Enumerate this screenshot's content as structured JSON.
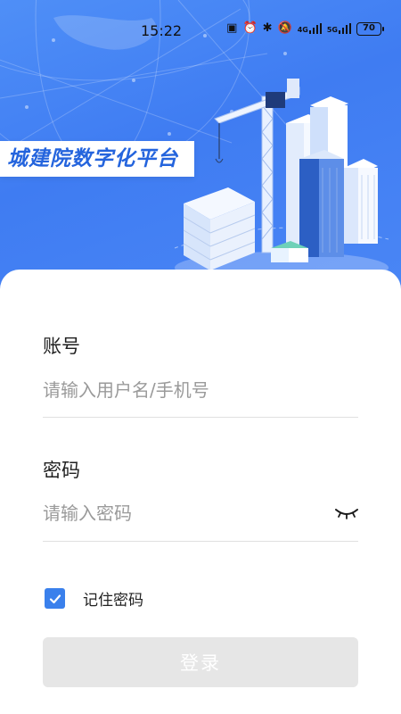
{
  "status_bar": {
    "time": "15:22",
    "network_4g": "4G",
    "network_5g": "5G",
    "battery": "70"
  },
  "app": {
    "title": "城建院数字化平台"
  },
  "form": {
    "account_label": "账号",
    "account_placeholder": "请输入用户名/手机号",
    "account_value": "",
    "password_label": "密码",
    "password_placeholder": "请输入密码",
    "password_value": "",
    "remember_label": "记住密码",
    "remember_checked": true,
    "login_label": "登录",
    "login_enabled": false
  },
  "colors": {
    "brand_blue": "#3f7cf2",
    "title_blue": "#2464dd",
    "checkbox_blue": "#3a80ec",
    "disabled_button": "#e6e6e6"
  },
  "icons": {
    "password_toggle": "eye-closed-icon",
    "checkbox": "check-icon"
  }
}
